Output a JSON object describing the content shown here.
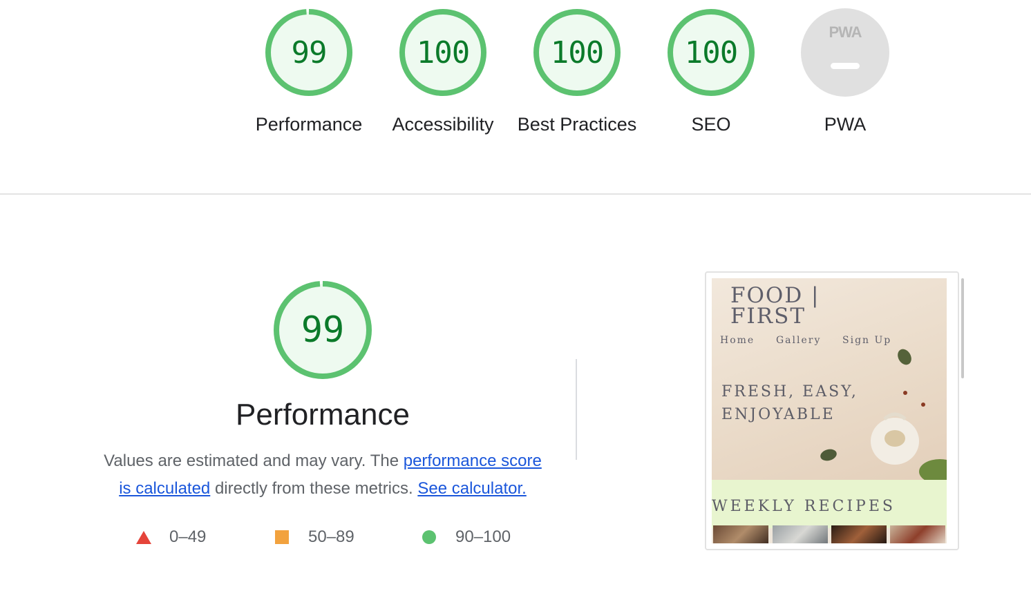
{
  "categories": [
    {
      "score": "99",
      "label": "Performance",
      "fraction": 0.99
    },
    {
      "score": "100",
      "label": "Accessibility",
      "fraction": 1.0
    },
    {
      "score": "100",
      "label": "Best Practices",
      "fraction": 1.0
    },
    {
      "score": "100",
      "label": "SEO",
      "fraction": 1.0
    }
  ],
  "pwa": {
    "badge_text": "PWA",
    "label": "PWA"
  },
  "performance": {
    "score": "99",
    "fraction": 0.99,
    "title": "Performance",
    "desc_start": "Values are estimated and may vary. The ",
    "link_score": "performance score is calculated",
    "desc_mid": " directly from these metrics. ",
    "link_calc": "See calculator."
  },
  "legend": [
    {
      "range": "0–49",
      "shape": "triangle",
      "color": "#e5443a"
    },
    {
      "range": "50–89",
      "shape": "square",
      "color": "#f2a23e"
    },
    {
      "range": "90–100",
      "shape": "circle",
      "color": "#5cc270"
    }
  ],
  "screenshot": {
    "logo_line1": "FOOD |",
    "logo_line2": "FIRST",
    "nav": [
      "Home",
      "Gallery",
      "Sign Up"
    ],
    "tagline_line1": "FRESH, EASY,",
    "tagline_line2": "ENJOYABLE",
    "section_title": "WEEKLY RECIPES"
  },
  "colors": {
    "pass": "#0b7a2a",
    "pass_ring": "#5cc270",
    "pass_fill": "#eefaf0",
    "link": "#1a56db"
  }
}
